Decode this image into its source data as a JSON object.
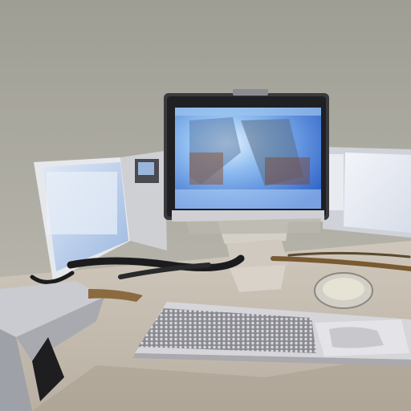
{
  "scene": {
    "colors": {
      "wall_top": "#9f9e94",
      "wall_bottom": "#b3b2a8",
      "desk_top": "#c8c0b4",
      "desk_front": "#b8b0a3",
      "monitor_bezel": "#2a2a2c",
      "monitor_frame": "#b8b8bc",
      "screen_bright": "#d6ecff",
      "screen_mid": "#6fa6e6",
      "screen_deep": "#2f63c8",
      "side_screen": "#eef2fa",
      "side_screen_blue": "#b7cde8",
      "keyboard": "#d9d9dc",
      "keys": "#707078",
      "cable": "#1c1c1e",
      "wood": "#7a5a32"
    }
  }
}
